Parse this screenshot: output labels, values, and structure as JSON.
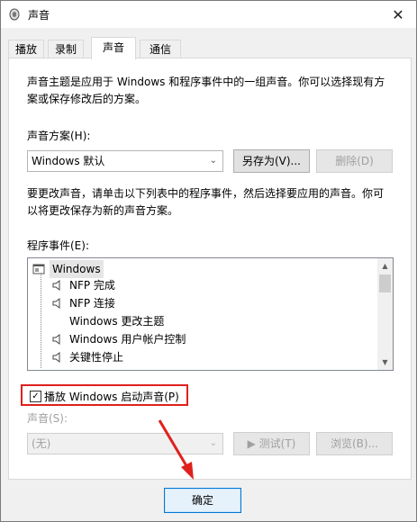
{
  "window": {
    "title": "声音",
    "close_glyph": "✕"
  },
  "tabs": [
    {
      "label": "播放"
    },
    {
      "label": "录制"
    },
    {
      "label": "声音"
    },
    {
      "label": "通信"
    }
  ],
  "panel": {
    "description_line1": "声音主题是应用于 Windows 和程序事件中的一组声音。你可以选择现有方",
    "description_line2": "案或保存修改后的方案。",
    "scheme_label": "声音方案(H):",
    "scheme_value": "Windows 默认",
    "save_as_label": "另存为(V)...",
    "delete_label": "删除(D)",
    "instruction_line1": "要更改声音，请单击以下列表中的程序事件，然后选择要应用的声音。你可",
    "instruction_line2": "以将更改保存为新的声音方案。",
    "events_label": "程序事件(E):",
    "events": [
      {
        "label": "Windows",
        "icon": "window-icon"
      },
      {
        "label": "NFP 完成",
        "icon": "speaker-icon"
      },
      {
        "label": "NFP 连接",
        "icon": "speaker-icon"
      },
      {
        "label": "Windows 更改主题",
        "icon": "none"
      },
      {
        "label": "Windows 用户帐户控制",
        "icon": "speaker-icon"
      },
      {
        "label": "关键性停止",
        "icon": "speaker-icon"
      }
    ],
    "startup_sound_label": "播放 Windows 启动声音(P)",
    "startup_sound_checked": true,
    "sound_label": "声音(S):",
    "sound_value": "(无)",
    "test_label": "▶ 测试(T)",
    "browse_label": "浏览(B)..."
  },
  "footer": {
    "ok_label": "确定"
  },
  "colors": {
    "highlight_red": "#e0201c",
    "accent_blue": "#0078d7"
  }
}
